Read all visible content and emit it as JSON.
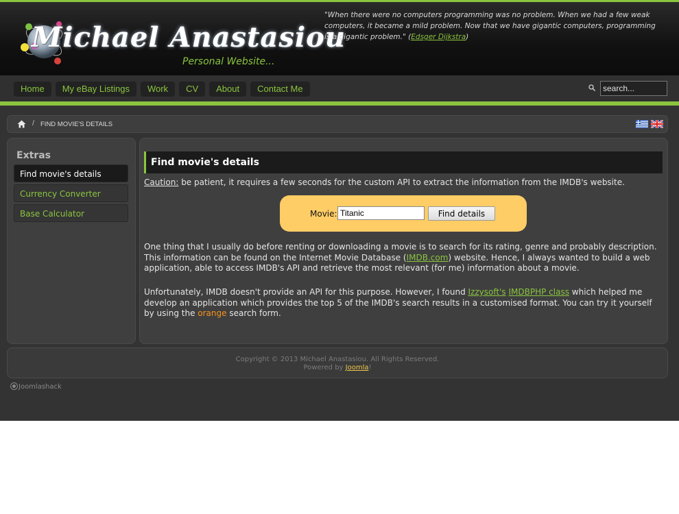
{
  "header": {
    "logo_name": "Michael Anastasiou",
    "logo_tagline": "Personal Website...",
    "quote_text": "\"When there were no computers programming was no problem. When we had a few weak computers, it became a mild problem. Now that we have gigantic computers, programming is a gigantic problem.\" (",
    "quote_author": "Edsger Dijkstra",
    "quote_close": ")"
  },
  "nav": {
    "items": [
      {
        "label": "Home"
      },
      {
        "label": "My eBay Listings"
      },
      {
        "label": "Work"
      },
      {
        "label": "CV"
      },
      {
        "label": "About"
      },
      {
        "label": "Contact Me"
      }
    ],
    "search_placeholder": "search..."
  },
  "breadcrumb": {
    "separator": "/",
    "current": "FIND MOVIE'S DETAILS"
  },
  "sidebar": {
    "title": "Extras",
    "items": [
      {
        "label": "Find movie's details",
        "active": true
      },
      {
        "label": "Currency Converter",
        "active": false
      },
      {
        "label": "Base Calculator",
        "active": false
      }
    ]
  },
  "main": {
    "title": "Find movie's details",
    "caution_label": "Caution:",
    "caution_text": " be patient, it requires a few seconds for the custom API to extract the information from the IMDB's website.",
    "form": {
      "label": "Movie:",
      "movie_value": "Titanic",
      "button_label": "Find details"
    },
    "para1_a": "One thing that I usually do before renting or downloading a movie is to search for its rating, genre and probably description. This information can be found on the Internet Movie Database (",
    "para1_link": "IMDB.com",
    "para1_b": ") website. Hence, I always wanted to build a web application, able to access IMDB's API and retrieve the most relevant (for me) information about a movie.",
    "para2_a": "Unfortunately, IMDB doesn't provide an API for this purpose. However, I found ",
    "para2_link1": "Izzysoft's",
    "para2_space": " ",
    "para2_link2": "IMDBPHP class",
    "para2_b": " which helped me develop an application which provides the top 5 of the IMDB's search results in a customised format. You can try it yourself by using the ",
    "para2_orange": "orange",
    "para2_c": " search form."
  },
  "footer": {
    "copyright": "Copyright © 2013 Michael Anastasiou. All Rights Reserved.",
    "powered_by": "Powered by ",
    "joomla_link": "Joomla",
    "powered_end": "!",
    "credit": "Joomlashack"
  },
  "colors": {
    "accent_green": "#8bc53f",
    "form_background": "#ffcd66",
    "orange_text": "#f7941d",
    "page_background": "#333333"
  },
  "icons": [
    "logo-orb-icon",
    "search-icon",
    "home-icon",
    "greek-flag-icon",
    "uk-flag-icon",
    "joomlashack-icon"
  ]
}
